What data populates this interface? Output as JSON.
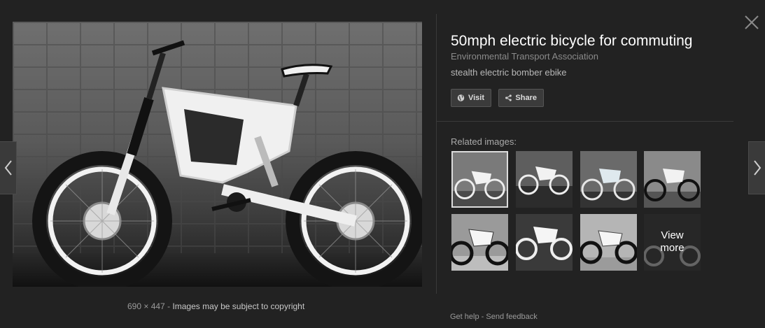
{
  "image": {
    "dimensions": "690 × 447",
    "separator": "-",
    "copyright": "Images may be subject to copyright"
  },
  "details": {
    "title": "50mph electric bicycle for commuting",
    "source": "Environmental Transport Association",
    "description": "stealth electric bomber ebike"
  },
  "actions": {
    "visit_label": "Visit",
    "share_label": "Share"
  },
  "related": {
    "label": "Related images:",
    "view_more_line1": "View",
    "view_more_line2": "more"
  },
  "footer": {
    "help": "Get help",
    "separator": "-",
    "feedback": "Send feedback"
  },
  "icons": {
    "visit": "globe-icon",
    "share": "share-icon",
    "close": "close-icon",
    "prev": "chevron-left-icon",
    "next": "chevron-right-icon"
  }
}
